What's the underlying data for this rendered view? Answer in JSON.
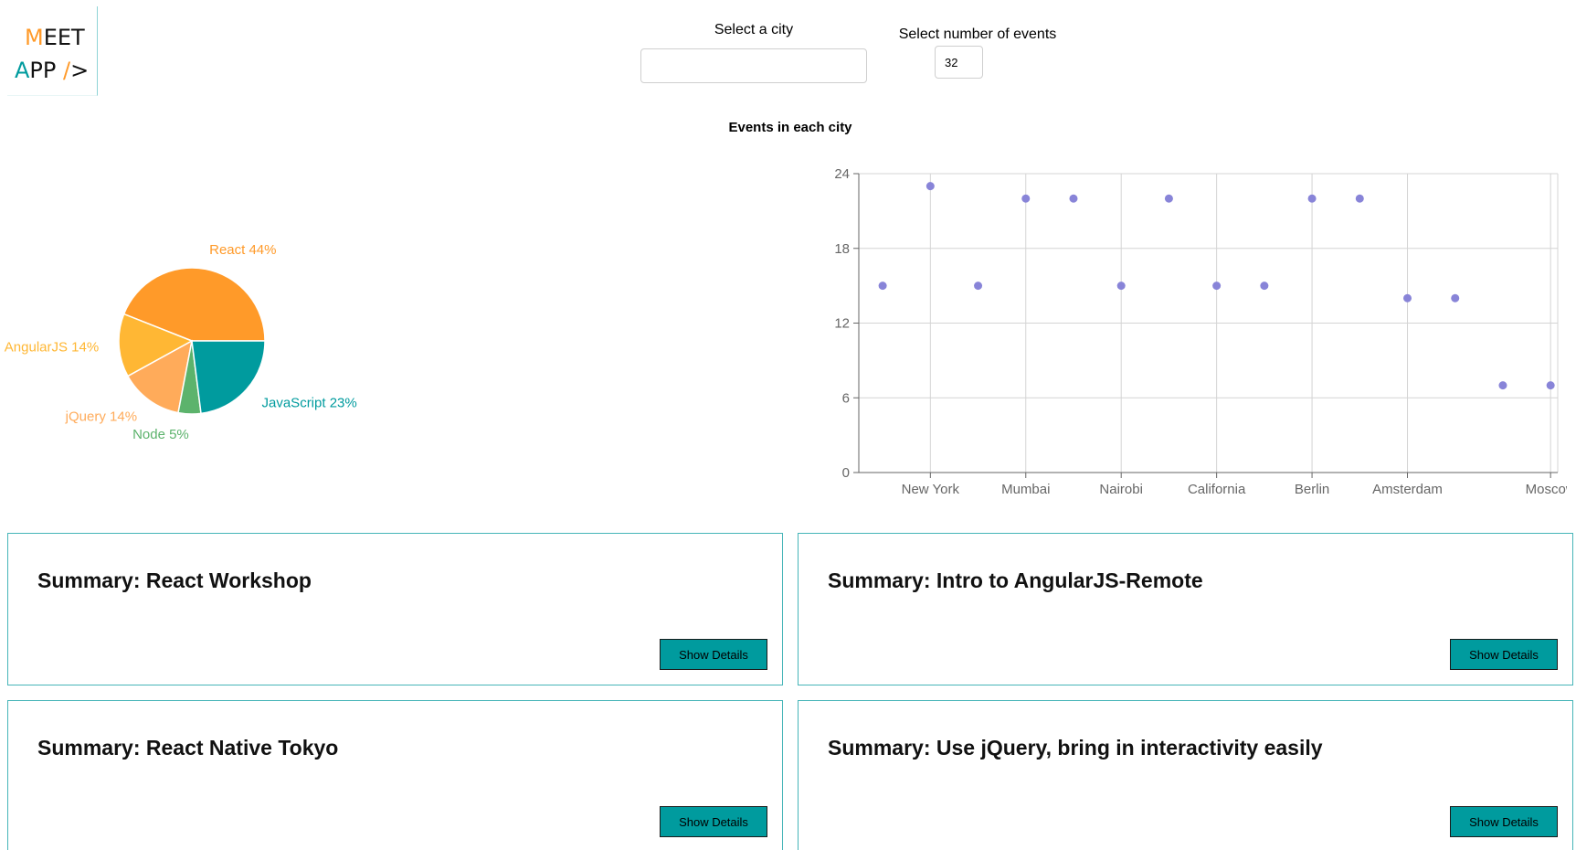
{
  "logo": {
    "line1_accent": "M",
    "line1_rest": "EET",
    "line2_accent": "A",
    "line2_rest": "PP ",
    "line2_slash": "/",
    "line2_end": ">"
  },
  "city_search": {
    "label": "Select a city",
    "value": "",
    "placeholder": ""
  },
  "number_of_events": {
    "label": "Select number of events",
    "value": "32"
  },
  "chart_title": "Events in each city",
  "colors": {
    "accent": "#009b9e",
    "orange": "#ff9a29",
    "border": "#46b5b8",
    "scatter_point": "#8884d8"
  },
  "chart_data": [
    {
      "type": "pie",
      "slices": [
        {
          "name": "React",
          "label": "React 44%",
          "value": 44,
          "color": "#ff9a29"
        },
        {
          "name": "AngularJS",
          "label": "AngularJS 14%",
          "value": 14,
          "color": "#ffb734"
        },
        {
          "name": "jQuery",
          "label": "jQuery 14%",
          "value": 14,
          "color": "#ffab5a"
        },
        {
          "name": "Node",
          "label": "Node 5%",
          "value": 5,
          "color": "#5cb36c"
        },
        {
          "name": "JavaScript",
          "label": "JavaScript 23%",
          "value": 23,
          "color": "#009b9e"
        }
      ]
    },
    {
      "type": "scatter",
      "title": "Events in each city",
      "ylim": [
        0,
        24
      ],
      "yticks": [
        0,
        6,
        12,
        18,
        24
      ],
      "xtick_labels": [
        "New York",
        "Mumbai",
        "Nairobi",
        "California",
        "Berlin",
        "Amsterdam",
        "Moscow"
      ],
      "grid": true,
      "points": [
        {
          "city": "",
          "y": 15
        },
        {
          "city": "New York",
          "y": 23
        },
        {
          "city": "",
          "y": 15
        },
        {
          "city": "Mumbai",
          "y": 22
        },
        {
          "city": "",
          "y": 22
        },
        {
          "city": "Nairobi",
          "y": 15
        },
        {
          "city": "",
          "y": 22
        },
        {
          "city": "California",
          "y": 15
        },
        {
          "city": "",
          "y": 15
        },
        {
          "city": "Berlin",
          "y": 22
        },
        {
          "city": "",
          "y": 22
        },
        {
          "city": "Amsterdam",
          "y": 14
        },
        {
          "city": "",
          "y": 14
        },
        {
          "city": "",
          "y": 7
        },
        {
          "city": "Moscow",
          "y": 7
        }
      ]
    }
  ],
  "events": [
    {
      "summary": "Summary: React Workshop",
      "button_label": "Show Details"
    },
    {
      "summary": "Summary: Intro to AngularJS-Remote",
      "button_label": "Show Details"
    },
    {
      "summary": "Summary: React Native Tokyo",
      "button_label": "Show Details"
    },
    {
      "summary": "Summary: Use jQuery, bring in interactivity easily",
      "button_label": "Show Details"
    }
  ]
}
